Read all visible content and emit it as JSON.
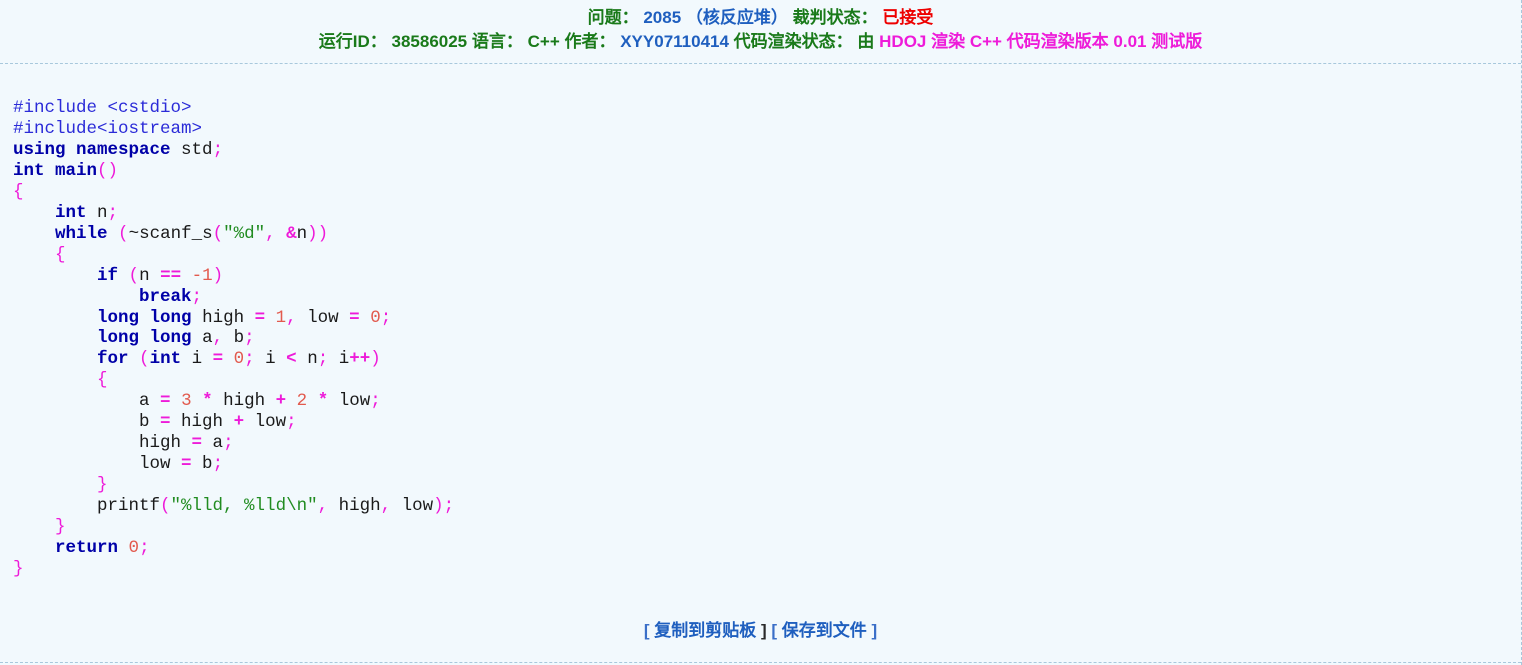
{
  "header": {
    "problem_label": "问题：",
    "problem_id": "2085",
    "problem_title": "（核反应堆）",
    "judge_label": "裁判状态：",
    "judge_status": "已接受",
    "run_id_label": "运行ID：",
    "run_id": "38586025",
    "language_label": "语言：",
    "language": "C++",
    "author_label": "作者：",
    "author": "XYY07110414",
    "render_label": "代码渲染状态：",
    "render_by": "由",
    "render_info": "HDOJ 渲染 C++ 代码渲染版本 0.01 测试版"
  },
  "code": {
    "lines": [
      [
        [
          "pp",
          "#include <cstdio>"
        ]
      ],
      [
        [
          "pp",
          "#include<iostream>"
        ]
      ],
      [
        [
          "kw",
          "using"
        ],
        [
          "t",
          " "
        ],
        [
          "kw",
          "namespace"
        ],
        [
          "t",
          " std"
        ],
        [
          "p",
          ";"
        ]
      ],
      [
        [
          "kw",
          "int"
        ],
        [
          "t",
          " "
        ],
        [
          "kw",
          "main"
        ],
        [
          "p",
          "()"
        ]
      ],
      [
        [
          "p",
          "{"
        ]
      ],
      [
        [
          "t",
          "    "
        ],
        [
          "kw",
          "int"
        ],
        [
          "t",
          " n"
        ],
        [
          "p",
          ";"
        ]
      ],
      [
        [
          "t",
          "    "
        ],
        [
          "kw",
          "while"
        ],
        [
          "t",
          " "
        ],
        [
          "p",
          "("
        ],
        [
          "t",
          "~scanf_s"
        ],
        [
          "p",
          "("
        ],
        [
          "s",
          "\"%d\""
        ],
        [
          "p",
          ","
        ],
        [
          "t",
          " "
        ],
        [
          "op",
          "&"
        ],
        [
          "t",
          "n"
        ],
        [
          "p",
          "))"
        ]
      ],
      [
        [
          "t",
          "    "
        ],
        [
          "p",
          "{"
        ]
      ],
      [
        [
          "t",
          "        "
        ],
        [
          "kw",
          "if"
        ],
        [
          "t",
          " "
        ],
        [
          "p",
          "("
        ],
        [
          "t",
          "n "
        ],
        [
          "op",
          "=="
        ],
        [
          "t",
          " "
        ],
        [
          "n",
          "-1"
        ],
        [
          "p",
          ")"
        ]
      ],
      [
        [
          "t",
          "            "
        ],
        [
          "kw",
          "break"
        ],
        [
          "p",
          ";"
        ]
      ],
      [
        [
          "t",
          "        "
        ],
        [
          "kw",
          "long"
        ],
        [
          "t",
          " "
        ],
        [
          "kw",
          "long"
        ],
        [
          "t",
          " high "
        ],
        [
          "op",
          "="
        ],
        [
          "t",
          " "
        ],
        [
          "n",
          "1"
        ],
        [
          "p",
          ","
        ],
        [
          "t",
          " low "
        ],
        [
          "op",
          "="
        ],
        [
          "t",
          " "
        ],
        [
          "n",
          "0"
        ],
        [
          "p",
          ";"
        ]
      ],
      [
        [
          "t",
          "        "
        ],
        [
          "kw",
          "long"
        ],
        [
          "t",
          " "
        ],
        [
          "kw",
          "long"
        ],
        [
          "t",
          " a"
        ],
        [
          "p",
          ","
        ],
        [
          "t",
          " b"
        ],
        [
          "p",
          ";"
        ]
      ],
      [
        [
          "t",
          "        "
        ],
        [
          "kw",
          "for"
        ],
        [
          "t",
          " "
        ],
        [
          "p",
          "("
        ],
        [
          "kw",
          "int"
        ],
        [
          "t",
          " i "
        ],
        [
          "op",
          "="
        ],
        [
          "t",
          " "
        ],
        [
          "n",
          "0"
        ],
        [
          "p",
          ";"
        ],
        [
          "t",
          " i "
        ],
        [
          "op",
          "<"
        ],
        [
          "t",
          " n"
        ],
        [
          "p",
          ";"
        ],
        [
          "t",
          " i"
        ],
        [
          "op",
          "++"
        ],
        [
          "p",
          ")"
        ]
      ],
      [
        [
          "t",
          "        "
        ],
        [
          "p",
          "{"
        ]
      ],
      [
        [
          "t",
          "            a "
        ],
        [
          "op",
          "="
        ],
        [
          "t",
          " "
        ],
        [
          "n",
          "3"
        ],
        [
          "t",
          " "
        ],
        [
          "op",
          "*"
        ],
        [
          "t",
          " high "
        ],
        [
          "op",
          "+"
        ],
        [
          "t",
          " "
        ],
        [
          "n",
          "2"
        ],
        [
          "t",
          " "
        ],
        [
          "op",
          "*"
        ],
        [
          "t",
          " low"
        ],
        [
          "p",
          ";"
        ]
      ],
      [
        [
          "t",
          "            b "
        ],
        [
          "op",
          "="
        ],
        [
          "t",
          " high "
        ],
        [
          "op",
          "+"
        ],
        [
          "t",
          " low"
        ],
        [
          "p",
          ";"
        ]
      ],
      [
        [
          "t",
          "            high "
        ],
        [
          "op",
          "="
        ],
        [
          "t",
          " a"
        ],
        [
          "p",
          ";"
        ]
      ],
      [
        [
          "t",
          "            low "
        ],
        [
          "op",
          "="
        ],
        [
          "t",
          " b"
        ],
        [
          "p",
          ";"
        ]
      ],
      [
        [
          "t",
          "        "
        ],
        [
          "p",
          "}"
        ]
      ],
      [
        [
          "t",
          "        printf"
        ],
        [
          "p",
          "("
        ],
        [
          "s",
          "\"%lld, %lld\\n\""
        ],
        [
          "p",
          ","
        ],
        [
          "t",
          " high"
        ],
        [
          "p",
          ","
        ],
        [
          "t",
          " low"
        ],
        [
          "p",
          ");"
        ]
      ],
      [
        [
          "t",
          "    "
        ],
        [
          "p",
          "}"
        ]
      ],
      [
        [
          "t",
          "    "
        ],
        [
          "kw",
          "return"
        ],
        [
          "t",
          " "
        ],
        [
          "n",
          "0"
        ],
        [
          "p",
          ";"
        ]
      ],
      [
        [
          "p",
          "}"
        ]
      ]
    ]
  },
  "footer": {
    "copy_label": "复制到剪贴板",
    "save_label": "保存到文件"
  }
}
